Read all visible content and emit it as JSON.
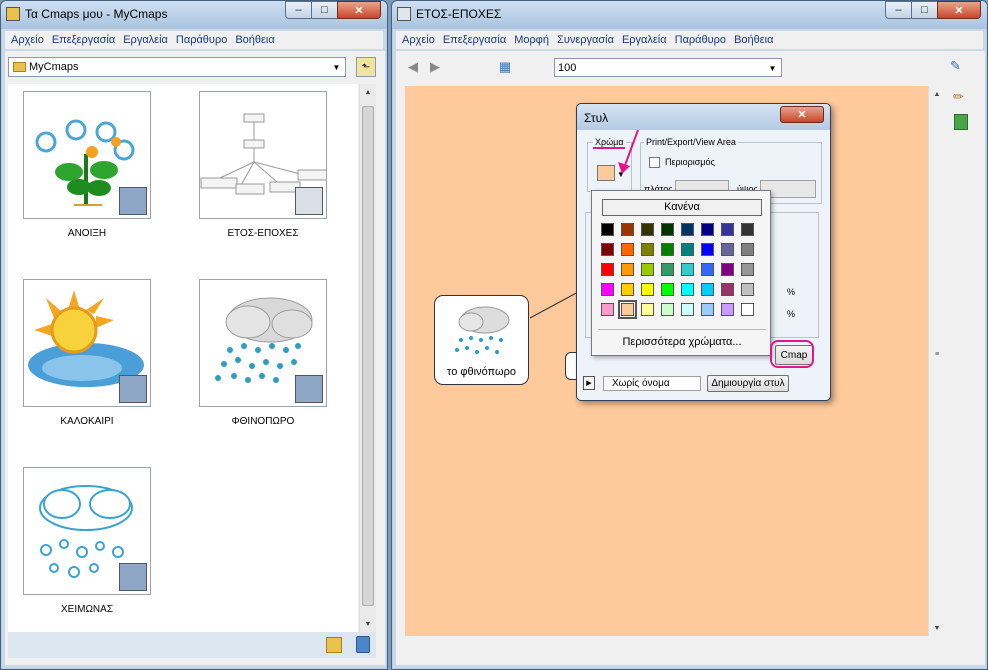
{
  "left_window": {
    "title": "Τα Cmaps μου - MyCmaps",
    "menu": [
      "Αρχείο",
      "Επεξεργασία",
      "Εργαλεία",
      "Παράθυρο",
      "Βοήθεια"
    ],
    "folder": "MyCmaps",
    "items": [
      {
        "label": "ΑΝΟΙΞΗ",
        "icon": "flower-icon"
      },
      {
        "label": "ΕΤΟΣ-ΕΠΟΧΕΣ",
        "icon": "concept-map-icon"
      },
      {
        "label": "ΚΑΛΟΚΑΙΡΙ",
        "icon": "sun-icon"
      },
      {
        "label": "ΦΘΙΝΟΠΩΡΟ",
        "icon": "rain-cloud-icon"
      },
      {
        "label": "ΧΕΙΜΩΝΑΣ",
        "icon": "snow-cloud-icon"
      }
    ]
  },
  "right_window": {
    "title": "ΕΤΟΣ-ΕΠΟΧΕΣ",
    "menu": [
      "Αρχείο",
      "Επεξεργασία",
      "Μορφή",
      "Συνεργασία",
      "Εργαλεία",
      "Παράθυρο",
      "Βοήθεια"
    ],
    "zoom": "100",
    "canvas_color": "#fec99b",
    "node_label": "το φθινόπωρο"
  },
  "style_dialog": {
    "title": "Στυλ",
    "color_group": "Χρώμα",
    "print_group": "Print/Export/View Area",
    "limit_checkbox": "Περιορισμός",
    "width_label": "πλάτος",
    "height_label": "ύψος",
    "percent": "%",
    "none_button": "Κανένα",
    "more_colors": "Περισσότερα χρώματα...",
    "cmap_tab": "Cmap",
    "style_name": "Χωρίς όνομα",
    "create_style": "Δημιουργία στυλ",
    "palette": [
      [
        "#000000",
        "#993300",
        "#333300",
        "#003300",
        "#003366",
        "#000080",
        "#333399",
        "#333333"
      ],
      [
        "#800000",
        "#ff6600",
        "#808000",
        "#008000",
        "#008080",
        "#0000ff",
        "#666699",
        "#808080"
      ],
      [
        "#ff0000",
        "#ff9900",
        "#99cc00",
        "#339966",
        "#33cccc",
        "#3366ff",
        "#800080",
        "#969696"
      ],
      [
        "#ff00ff",
        "#ffcc00",
        "#ffff00",
        "#00ff00",
        "#00ffff",
        "#00ccff",
        "#993366",
        "#c0c0c0"
      ],
      [
        "#ff99cc",
        "#ffcc99",
        "#ffff99",
        "#ccffcc",
        "#ccffff",
        "#99ccff",
        "#cc99ff",
        "#ffffff"
      ]
    ],
    "selected_swatch": "#ffcc99"
  }
}
